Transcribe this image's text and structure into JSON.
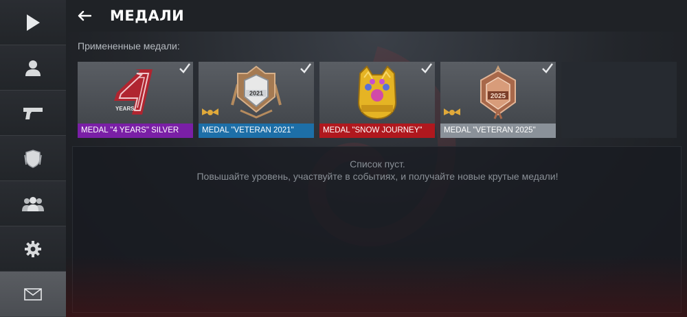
{
  "header": {
    "title": "МЕДАЛИ"
  },
  "applied": {
    "label": "Примененные медали:",
    "slots": [
      {
        "label": "MEDAL \"4 YEARS\" SILVER",
        "color": "#7a1fa6",
        "checked": true,
        "wings": false,
        "art": "4-years-medal"
      },
      {
        "label": "MEDAL \"VETERAN 2021\"",
        "color": "#1d6fa8",
        "checked": true,
        "wings": true,
        "art": "veteran-2021-medal",
        "art_text": "2021"
      },
      {
        "label": "MEDAL \"SNOW JOURNEY\"",
        "color": "#b0181e",
        "checked": true,
        "wings": false,
        "art": "snow-journey-medal"
      },
      {
        "label": "MEDAL \"VETERAN 2025\"",
        "color": "#8a9199",
        "checked": true,
        "wings": true,
        "art": "veteran-2025-medal",
        "art_text": "2025"
      }
    ]
  },
  "empty_state": {
    "title": "Список пуст.",
    "subtitle": "Повышайте уровень, участвуйте в событиях, и получайте новые крутые медали!"
  },
  "sidebar": {
    "items": [
      {
        "name": "play",
        "icon": "play-icon"
      },
      {
        "name": "profile",
        "icon": "profile-icon"
      },
      {
        "name": "weapons",
        "icon": "pistol-icon"
      },
      {
        "name": "clan",
        "icon": "shield-icon"
      },
      {
        "name": "friends",
        "icon": "friends-icon"
      },
      {
        "name": "settings",
        "icon": "gear-icon"
      },
      {
        "name": "mail",
        "icon": "mail-icon",
        "active": true
      }
    ]
  }
}
